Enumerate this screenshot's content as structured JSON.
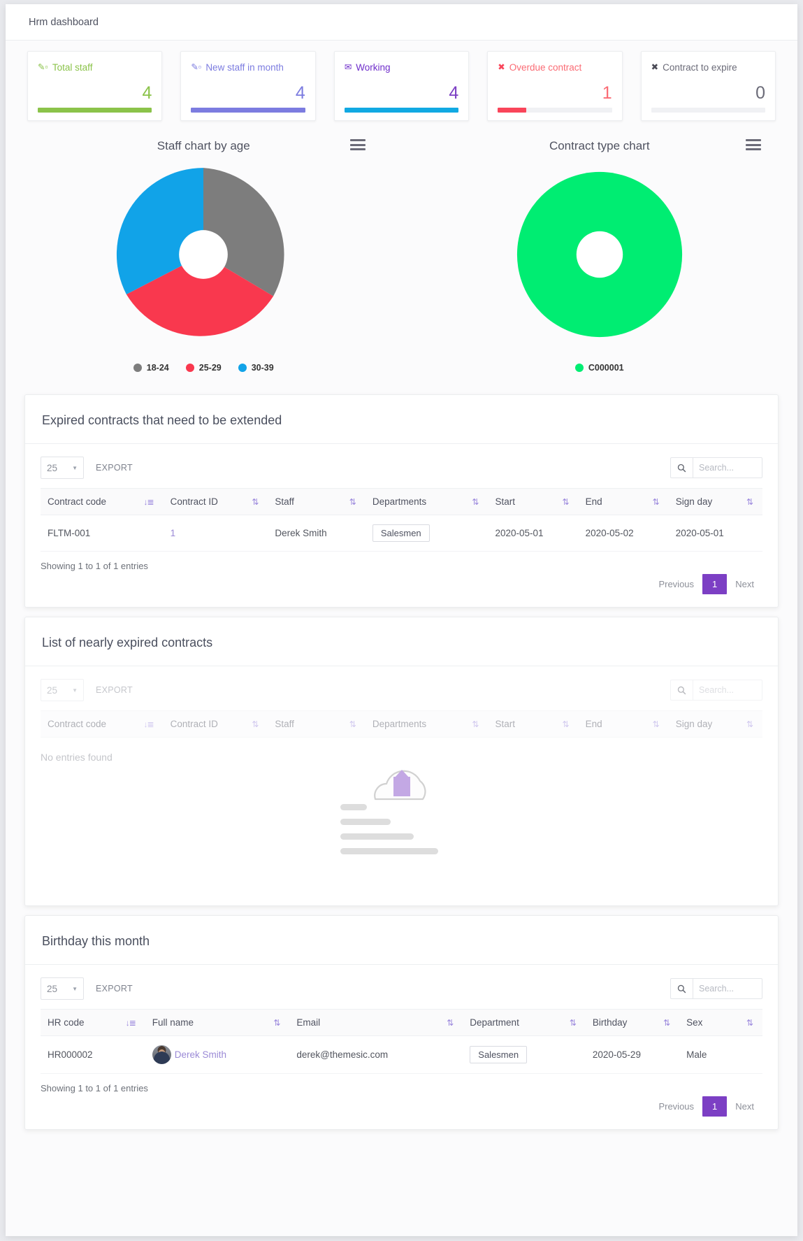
{
  "breadcrumb": {
    "title": "Hrm dashboard"
  },
  "stats": [
    {
      "label": "Total staff",
      "icon": "edit-square-icon",
      "value": "4",
      "color": "#8bc34a",
      "fill_pct": 100
    },
    {
      "label": "New staff in month",
      "icon": "edit-square-icon",
      "value": "4",
      "color": "#7c7ce0",
      "fill_pct": 100
    },
    {
      "label": "Working",
      "icon": "envelope-icon",
      "value": "4",
      "color": "#11a9e2",
      "fill_pct": 100
    },
    {
      "label": "Overdue contract",
      "icon": "times-icon",
      "value": "1",
      "color": "#f9455a",
      "fill_pct": 25
    },
    {
      "label": "Contract to expire",
      "icon": "times-icon",
      "value": "0",
      "color": "#6b6b78",
      "fill_pct": 0
    }
  ],
  "charts": [
    {
      "title": "Staff chart by age",
      "menu_icon": "hamburger-menu-icon",
      "chart_data": {
        "type": "pie",
        "title": "Staff chart by age",
        "categories": [
          "18-24",
          "25-29",
          "30-39"
        ],
        "values": [
          1,
          2,
          1
        ],
        "percentages": [
          28,
          40,
          32
        ],
        "colors": [
          "#7d7d7d",
          "#f9384e",
          "#11a3e8"
        ],
        "legend_position": "bottom",
        "donut": true
      }
    },
    {
      "title": "Contract type chart",
      "menu_icon": "hamburger-menu-icon",
      "chart_data": {
        "type": "pie",
        "title": "Contract type chart",
        "categories": [
          "C000001"
        ],
        "values": [
          1
        ],
        "percentages": [
          100
        ],
        "colors": [
          "#00ed72"
        ],
        "legend_position": "bottom",
        "donut": true
      }
    }
  ],
  "panels": [
    {
      "title": "Expired contracts that need to be extended",
      "length_value": "25",
      "export_label": "EXPORT",
      "search_placeholder": "Search...",
      "search_value": "",
      "columns": [
        "Contract code",
        "Contract ID",
        "Staff",
        "Departments",
        "Start",
        "End",
        "Sign day"
      ],
      "rows": [
        {
          "contract_code": "FLTM-001",
          "contract_id": "1",
          "staff": "Derek Smith",
          "department": "Salesmen",
          "start": "2020-05-01",
          "end": "2020-05-02",
          "sign_day": "2020-05-01"
        }
      ],
      "showing": "Showing 1 to 1 of 1 entries",
      "pagination": {
        "previous": "Previous",
        "pages": [
          "1"
        ],
        "next": "Next",
        "active": "1"
      }
    },
    {
      "title": "List of nearly expired contracts",
      "length_value": "25",
      "export_label": "EXPORT",
      "search_placeholder": "Search...",
      "search_value": "",
      "columns": [
        "Contract code",
        "Contract ID",
        "Staff",
        "Departments",
        "Start",
        "End",
        "Sign day"
      ],
      "rows": [],
      "empty_text": "No entries found",
      "empty_art": "cloud-upload-illustration"
    },
    {
      "title": "Birthday this month",
      "length_value": "25",
      "export_label": "EXPORT",
      "search_placeholder": "Search...",
      "search_value": "",
      "columns": [
        "HR code",
        "Full name",
        "Email",
        "Department",
        "Birthday",
        "Sex"
      ],
      "rows": [
        {
          "hr_code": "HR000002",
          "full_name": "Derek Smith",
          "email": "derek@themesic.com",
          "department": "Salesmen",
          "birthday": "2020-05-29",
          "sex": "Male"
        }
      ],
      "showing": "Showing 1 to 1 of 1 entries",
      "pagination": {
        "previous": "Previous",
        "pages": [
          "1"
        ],
        "next": "Next",
        "active": "1"
      }
    }
  ],
  "theme": {
    "accent": "#7c3fc4",
    "link": "#9b8ad6",
    "sort_icon_color": "#9b88dd"
  }
}
